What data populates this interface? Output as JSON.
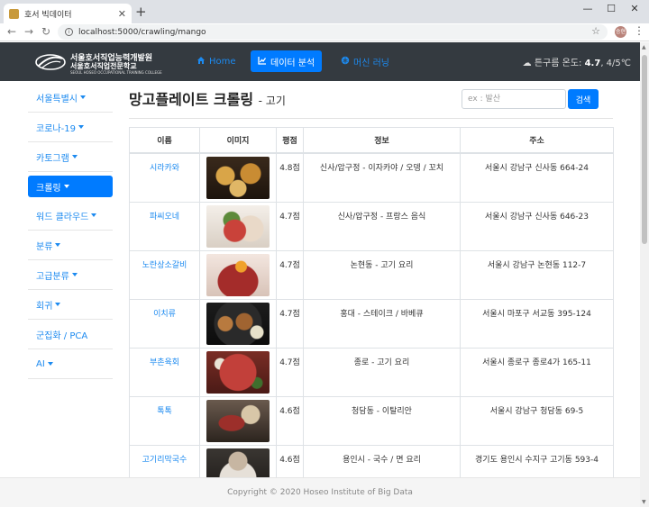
{
  "browser": {
    "tab_title": "호서 빅데이터",
    "url": "localhost:5000/crawling/mango",
    "profile_label": "승현"
  },
  "navbar": {
    "logo_line1": "서울호서직업능력개발원",
    "logo_line2": "서울호서직업전문학교",
    "logo_line3": "SEOUL HOSEO OCCUPATIONAL TRAINING COLLEGE",
    "links": [
      {
        "label": "Home",
        "icon": "home-icon"
      },
      {
        "label": "데이터 분석",
        "icon": "chart-icon"
      },
      {
        "label": "머신 러닝",
        "icon": "brain-icon"
      }
    ],
    "weather_text": "튼구름 온도: ",
    "weather_temp": "4.7",
    "weather_range": ", 4/5℃"
  },
  "sidebar": {
    "items": [
      {
        "label": "서울특별시",
        "caret": true
      },
      {
        "label": "코로나-19",
        "caret": true
      },
      {
        "label": "카토그램",
        "caret": true
      },
      {
        "label": "크롤링",
        "caret": true
      },
      {
        "label": "워드 클라우드",
        "caret": true
      },
      {
        "label": "분류",
        "caret": true
      },
      {
        "label": "고급분류",
        "caret": true
      },
      {
        "label": "회귀",
        "caret": true
      },
      {
        "label": "군집화 / PCA",
        "caret": false
      },
      {
        "label": "AI",
        "caret": true
      }
    ]
  },
  "main": {
    "title": "망고플레이트 크롤링",
    "subtitle": "- 고기",
    "search_placeholder": "ex : 발산",
    "search_button": "검색",
    "columns": [
      "이름",
      "이미지",
      "평점",
      "정보",
      "주소"
    ],
    "rows": [
      {
        "name": "시라카와",
        "rating": "4.8점",
        "info": "신사/압구정 - 이자카야 / 오뎅 / 꼬치",
        "address": "서울시 강남구 신사동 664-24"
      },
      {
        "name": "파씨오네",
        "rating": "4.7점",
        "info": "신사/압구정 - 프랑스 음식",
        "address": "서울시 강남구 신사동 646-23"
      },
      {
        "name": "노란상소갈비",
        "rating": "4.7점",
        "info": "논현동 - 고기 요리",
        "address": "서울시 강남구 논현동 112-7"
      },
      {
        "name": "이치류",
        "rating": "4.7점",
        "info": "홍대 - 스테이크 / 바베큐",
        "address": "서울시 마포구 서교동 395-124"
      },
      {
        "name": "부촌육회",
        "rating": "4.7점",
        "info": "종로 - 고기 요리",
        "address": "서울시 종로구 종로4가 165-11"
      },
      {
        "name": "톡톡",
        "rating": "4.6점",
        "info": "청담동 - 이탈리안",
        "address": "서울시 강남구 청담동 69-5"
      },
      {
        "name": "고기리막국수",
        "rating": "4.6점",
        "info": "용인시 - 국수 / 면 요리",
        "address": "경기도 용인시 수지구 고기동 593-4"
      }
    ]
  },
  "footer": {
    "text": "Copyright © 2020 Hoseo Institute of Big Data"
  },
  "colors": {
    "navbar": "#343a40",
    "accent": "#007bff",
    "link": "#1c8af0"
  }
}
